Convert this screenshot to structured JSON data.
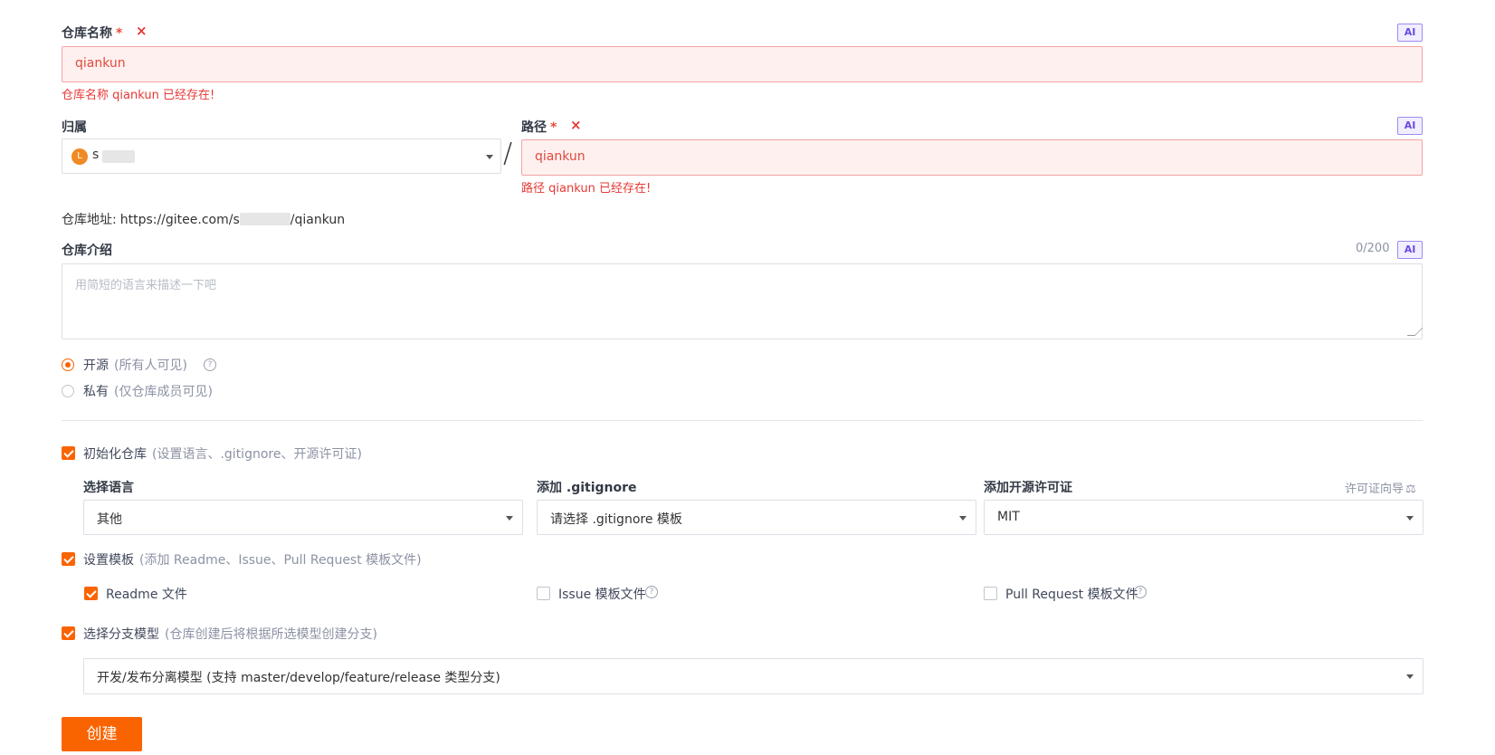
{
  "repo_name": {
    "label": "仓库名称",
    "required_mark": "*",
    "error_icon": "×",
    "ai_badge": "AI",
    "value": "qiankun",
    "error_prefix": "仓库名称 ",
    "error_value": "qiankun",
    "error_suffix": " 已经存在!"
  },
  "owner": {
    "label": "归属",
    "avatar_letter": "L",
    "value_visible": "s"
  },
  "separator": "/",
  "path": {
    "label": "路径",
    "required_mark": "*",
    "error_icon": "×",
    "ai_badge": "AI",
    "value": "qiankun",
    "error_prefix": "路径 ",
    "error_value": "qiankun",
    "error_suffix": " 已经存在!"
  },
  "repo_url": {
    "label": "仓库地址:",
    "url_prefix": "https://gitee.com/s",
    "url_suffix": "/qiankun"
  },
  "description": {
    "label": "仓库介绍",
    "counter": "0/200",
    "ai_badge": "AI",
    "placeholder": "用简短的语言来描述一下吧"
  },
  "visibility": {
    "options": [
      {
        "label": "开源",
        "hint": "(所有人可见)",
        "selected": true
      },
      {
        "label": "私有",
        "hint": "(仅仓库成员可见)",
        "selected": false
      }
    ],
    "help_icon": "?"
  },
  "init_repo": {
    "label": "初始化仓库",
    "hint": "(设置语言、.gitignore、开源许可证)",
    "checked": true,
    "language": {
      "label": "选择语言",
      "value": "其他"
    },
    "gitignore": {
      "label": "添加 .gitignore",
      "value": "请选择 .gitignore 模板"
    },
    "license": {
      "label": "添加开源许可证",
      "value": "MIT",
      "guide": "许可证向导",
      "guide_icon": "⚖"
    }
  },
  "templates": {
    "label": "设置模板",
    "hint": "(添加 Readme、Issue、Pull Request 模板文件)",
    "checked": true,
    "items": [
      {
        "label": "Readme 文件",
        "checked": true
      },
      {
        "label": "Issue 模板文件",
        "checked": false
      },
      {
        "label": "Pull Request 模板文件",
        "checked": false
      }
    ],
    "help_icon": "?"
  },
  "branch_model": {
    "label": "选择分支模型",
    "hint": "(仓库创建后将根据所选模型创建分支)",
    "checked": true,
    "value": "开发/发布分离模型 (支持 master/develop/feature/release 类型分支)"
  },
  "create_button": "创建",
  "colors": {
    "accent": "#fa6400",
    "error": "#e53935",
    "error_bg": "#fff0f0",
    "ai": "#6c4ae3"
  }
}
